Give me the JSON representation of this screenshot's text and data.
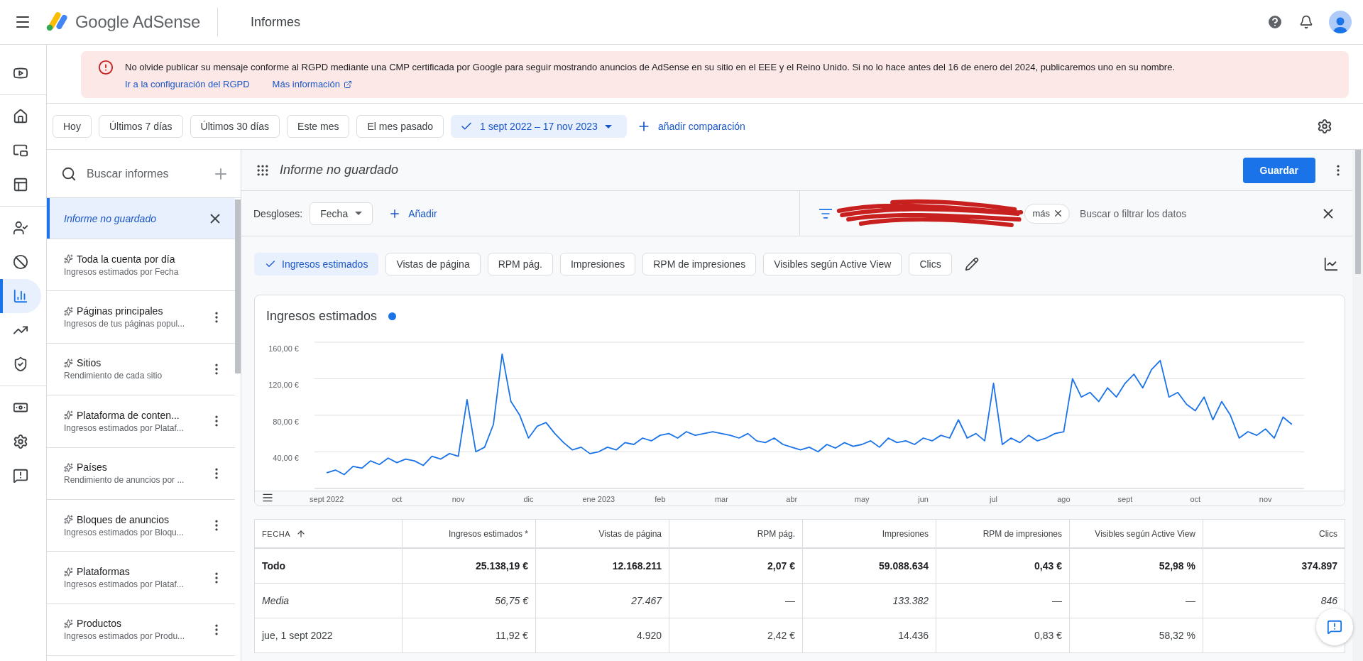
{
  "header": {
    "app_name": "Google AdSense",
    "page_title": "Informes"
  },
  "rail": {
    "groups": [
      {
        "items": [
          {
            "selected": false
          }
        ]
      },
      {
        "items": [
          {
            "selected": false
          },
          {
            "selected": false
          },
          {
            "selected": false
          }
        ]
      },
      {
        "items": [
          {
            "selected": false
          },
          {
            "selected": false
          },
          {
            "selected": true
          },
          {
            "selected": false
          },
          {
            "selected": false
          }
        ]
      },
      {
        "items": [
          {
            "selected": false
          },
          {
            "selected": false
          },
          {
            "selected": false
          }
        ]
      }
    ]
  },
  "banner": {
    "message": "No olvide publicar su mensaje conforme al RGPD mediante una CMP certificada por Google para seguir mostrando anuncios de AdSense en su sitio en el EEE y el Reino Unido. Si no lo hace antes del 16 de enero del 2024, publicaremos uno en su nombre.",
    "links": [
      {
        "label": "Ir a la configuración del RGPD",
        "external": false
      },
      {
        "label": "Más información",
        "external": true
      }
    ]
  },
  "date_ranges": [
    {
      "label": "Hoy",
      "selected": false
    },
    {
      "label": "Últimos 7 días",
      "selected": false
    },
    {
      "label": "Últimos 30 días",
      "selected": false
    },
    {
      "label": "Este mes",
      "selected": false
    },
    {
      "label": "El mes pasado",
      "selected": false
    },
    {
      "label": "1 sept 2022 – 17 nov 2023",
      "selected": true
    }
  ],
  "add_comparison": "añadir comparación",
  "sidebar": {
    "search": {
      "placeholder": "Buscar informes"
    },
    "reports": [
      {
        "kind": "unsaved",
        "title": "Informe no guardado",
        "selected": true
      },
      {
        "kind": "saved",
        "title": "Toda la cuenta por día",
        "subtitle": "Ingresos estimados por Fecha",
        "selected": false,
        "menu_button": false
      },
      {
        "kind": "saved",
        "title": "Páginas principales",
        "subtitle": "Ingresos de tus páginas popul...",
        "selected": false,
        "menu_button": true
      },
      {
        "kind": "saved",
        "title": "Sitios",
        "subtitle": "Rendimiento de cada sitio",
        "selected": false,
        "menu_button": true
      },
      {
        "kind": "saved",
        "title": "Plataforma de conten...",
        "subtitle": "Ingresos estimados por Plataf...",
        "selected": false,
        "menu_button": true
      },
      {
        "kind": "saved",
        "title": "Países",
        "subtitle": "Rendimiento de anuncios por ...",
        "selected": false,
        "menu_button": true
      },
      {
        "kind": "saved",
        "title": "Bloques de anuncios",
        "subtitle": "Ingresos estimados por Bloqu...",
        "selected": false,
        "menu_button": true
      },
      {
        "kind": "saved",
        "title": "Plataformas",
        "subtitle": "Ingresos estimados por Plataf...",
        "selected": false,
        "menu_button": true
      },
      {
        "kind": "saved",
        "title": "Productos",
        "subtitle": "Ingresos estimados por Produ...",
        "selected": false,
        "menu_button": true
      }
    ]
  },
  "report": {
    "title": "Informe no guardado",
    "save_button": "Guardar",
    "breakdowns": {
      "label": "Desgloses:",
      "value": "Fecha",
      "add": "Añadir"
    },
    "filter": {
      "chip": "más",
      "placeholder": "Buscar o filtrar los datos"
    },
    "metrics": [
      {
        "label": "Ingresos estimados",
        "selected": true
      },
      {
        "label": "Vistas de página",
        "selected": false
      },
      {
        "label": "RPM pág.",
        "selected": false
      },
      {
        "label": "Impresiones",
        "selected": false
      },
      {
        "label": "RPM de impresiones",
        "selected": false
      },
      {
        "label": "Visibles según Active View",
        "selected": false
      },
      {
        "label": "Clics",
        "selected": false
      }
    ],
    "chart": {
      "chart_data": {
        "type": "line",
        "grid": true,
        "ylim": [
          0,
          160
        ],
        "categories": [
          "sept 2022",
          null,
          null,
          null,
          null,
          null,
          null,
          null,
          "oct",
          null,
          null,
          null,
          null,
          null,
          null,
          "nov",
          null,
          null,
          null,
          null,
          null,
          null,
          null,
          "dic",
          null,
          null,
          null,
          null,
          null,
          null,
          null,
          "ene 2023",
          null,
          null,
          null,
          null,
          null,
          null,
          "feb",
          null,
          null,
          null,
          null,
          null,
          null,
          "mar",
          null,
          null,
          null,
          null,
          null,
          null,
          null,
          "abr",
          null,
          null,
          null,
          null,
          null,
          null,
          null,
          "may",
          null,
          null,
          null,
          null,
          null,
          null,
          "jun",
          null,
          null,
          null,
          null,
          null,
          null,
          null,
          "jul",
          null,
          null,
          null,
          null,
          null,
          null,
          null,
          "ago",
          null,
          null,
          null,
          null,
          null,
          null,
          "sept",
          null,
          null,
          null,
          null,
          null,
          null,
          null,
          "oct",
          null,
          null,
          null,
          null,
          null,
          null,
          null,
          "nov",
          null,
          null,
          null
        ],
        "yticks": [
          {
            "value": 40,
            "label": "40,00 €"
          },
          {
            "value": 80,
            "label": "80,00 €"
          },
          {
            "value": 120,
            "label": "120,00 €"
          },
          {
            "value": 160,
            "label": "160,00 €"
          }
        ],
        "series": [
          {
            "name": "Ingresos estimados",
            "color": "#1a73e8",
            "values": [
              17,
              20,
              15,
              24,
              22,
              30,
              26,
              33,
              28,
              32,
              30,
              25,
              35,
              32,
              38,
              35,
              97,
              40,
              45,
              70,
              147,
              95,
              80,
              55,
              68,
              72,
              60,
              50,
              42,
              45,
              38,
              40,
              45,
              42,
              50,
              48,
              55,
              52,
              58,
              60,
              55,
              62,
              58,
              60,
              62,
              60,
              58,
              55,
              60,
              52,
              50,
              55,
              48,
              45,
              42,
              45,
              40,
              48,
              44,
              50,
              46,
              48,
              52,
              45,
              55,
              50,
              52,
              48,
              55,
              52,
              58,
              55,
              75,
              55,
              60,
              52,
              115,
              48,
              55,
              50,
              58,
              52,
              55,
              60,
              62,
              120,
              100,
              105,
              95,
              110,
              100,
              115,
              125,
              110,
              130,
              140,
              100,
              105,
              92,
              85,
              100,
              75,
              95,
              80,
              55,
              62,
              58,
              65,
              55,
              78,
              70
            ]
          }
        ]
      }
    },
    "table": {
      "columns": [
        {
          "label": "FECHA",
          "sorted": true
        },
        {
          "label": "Ingresos estimados *",
          "sorted": false
        },
        {
          "label": "Vistas de página",
          "sorted": false
        },
        {
          "label": "RPM pág.",
          "sorted": false
        },
        {
          "label": "Impresiones",
          "sorted": false
        },
        {
          "label": "RPM de impresiones",
          "sorted": false
        },
        {
          "label": "Visibles según Active View",
          "sorted": false
        },
        {
          "label": "Clics",
          "sorted": false
        }
      ],
      "rows": [
        {
          "kind": "total",
          "cells": [
            "Todo",
            "25.138,19 €",
            "12.168.211",
            "2,07 €",
            "59.088.634",
            "0,43 €",
            "52,98 %",
            "374.897"
          ]
        },
        {
          "kind": "average",
          "cells": [
            "Media",
            "56,75 €",
            "27.467",
            "—",
            "133.382",
            "—",
            "—",
            "846"
          ]
        },
        {
          "kind": "day",
          "cells": [
            "jue, 1 sept 2022",
            "11,92 €",
            "4.920",
            "2,42 €",
            "14.436",
            "0,83 €",
            "58,32 %"
          ]
        }
      ]
    }
  }
}
